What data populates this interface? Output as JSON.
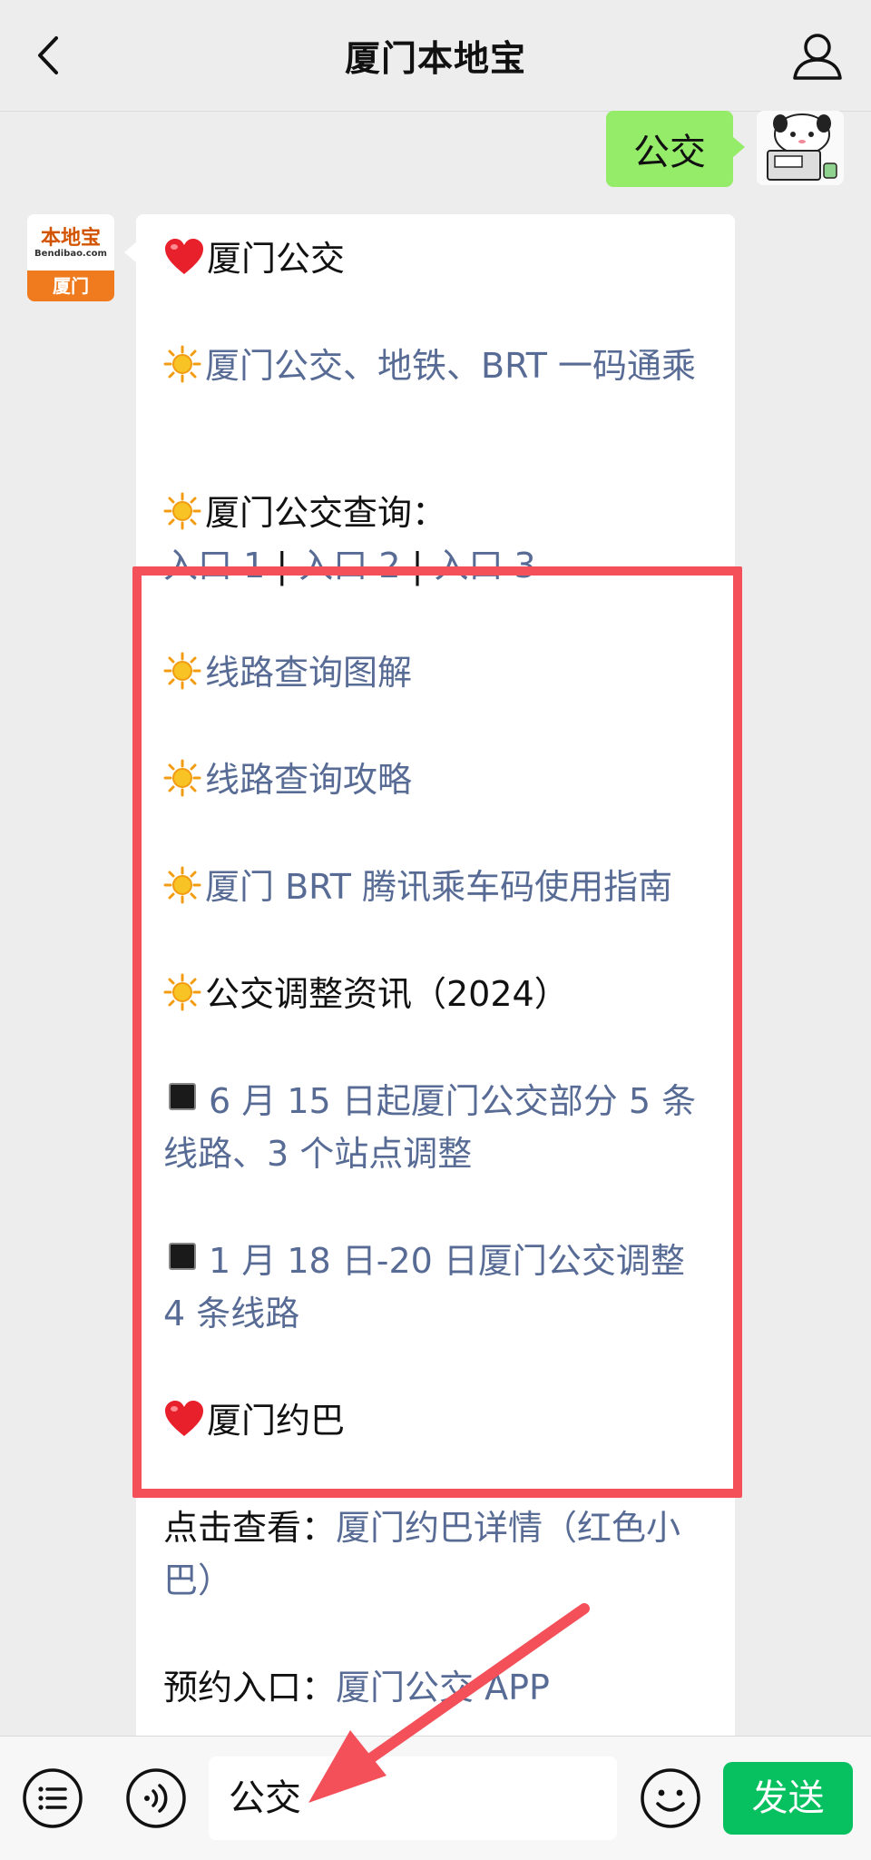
{
  "header": {
    "title": "厦门本地宝"
  },
  "chat": {
    "user_message": "公交",
    "bot_avatar": {
      "logo_text": "本地宝",
      "domain_text": "Bendibao.com",
      "city_text": "厦门"
    },
    "lines": [
      {
        "text": "厦门公交"
      },
      {
        "text": "厦门公交、地铁、BRT 一码通乘"
      },
      {
        "text": "厦门公交查询："
      },
      {
        "link1": "入口 1",
        "sep1": " | ",
        "link2": "入口 2",
        "sep2": " | ",
        "link3": "入口 3"
      },
      {
        "text": "线路查询图解"
      },
      {
        "text": "线路查询攻略"
      },
      {
        "text": "厦门 BRT 腾讯乘车码使用指南"
      },
      {
        "text": "公交调整资讯（2024）"
      },
      {
        "text": "6 月 15 日起厦门公交部分 5 条线路、3 个站点调整"
      },
      {
        "text": "1 月 18 日-20 日厦门公交调整 4 条线路"
      },
      {
        "text": "厦门约巴"
      },
      {
        "prefix": "点击查看：",
        "link": "厦门约巴详情（红色小巴）"
      },
      {
        "prefix": "预约入口：",
        "link": "厦门公交 APP"
      }
    ]
  },
  "input": {
    "value": "公交",
    "send_label": "发送"
  },
  "colors": {
    "link": "#576b95",
    "send": "#07c160",
    "highlight": "#f4505a",
    "user_bubble": "#95ec69"
  }
}
